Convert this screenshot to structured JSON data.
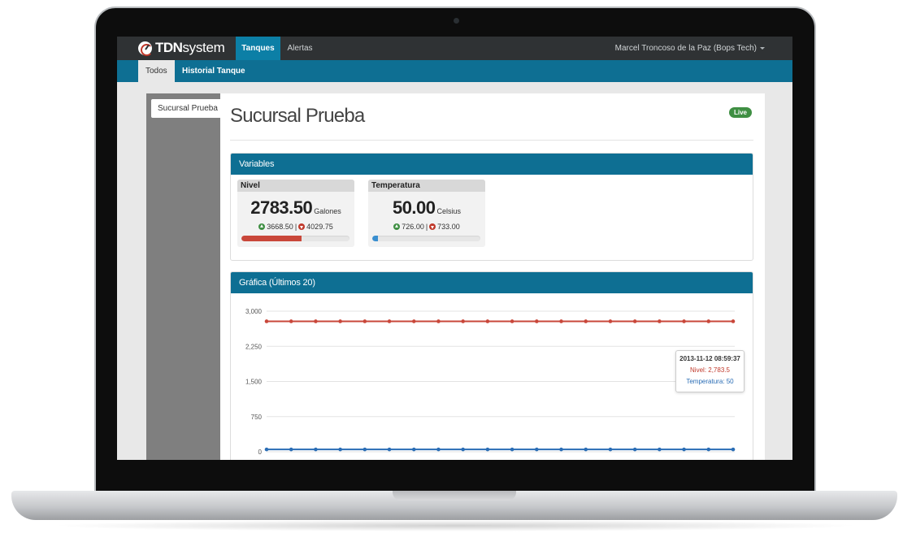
{
  "brand": {
    "name_bold": "TDN",
    "name_light": "system"
  },
  "nav": {
    "tabs": [
      {
        "label": "Tanques",
        "active": true
      },
      {
        "label": "Alertas",
        "active": false
      }
    ],
    "user": "Marcel Troncoso de la Paz (Bops Tech)"
  },
  "subnav": {
    "tabs": [
      {
        "label": "Todos",
        "active": true
      },
      {
        "label": "Historial Tanque",
        "active": false
      }
    ]
  },
  "sidebar": {
    "items": [
      {
        "label": "Sucursal Prueba"
      }
    ]
  },
  "main": {
    "title": "Sucursal Prueba",
    "badge": "Live",
    "variables_panel": {
      "title": "Variables",
      "cards": [
        {
          "name": "Nivel",
          "value": "2783.50",
          "unit": "Galones",
          "min": "3668.50",
          "max": "4029.75",
          "progress_percent": 56,
          "progress_color": "#c9473a"
        },
        {
          "name": "Temperatura",
          "value": "50.00",
          "unit": "Celsius",
          "min": "726.00",
          "max": "733.00",
          "progress_percent": 5,
          "progress_color": "#3a8fd0"
        }
      ]
    },
    "chart_panel": {
      "title": "Gráfica (Últimos 20)"
    }
  },
  "chart_data": {
    "type": "line",
    "title": "Gráfica (Últimos 20)",
    "ylim": [
      0,
      3000
    ],
    "yticks": [
      "3,000",
      "2,250",
      "1,500",
      "750",
      "0"
    ],
    "grid": true,
    "series": [
      {
        "name": "Nivel",
        "color": "#c9473a",
        "values": [
          2783.5,
          2783.5,
          2783.5,
          2783.5,
          2783.5,
          2783.5,
          2783.5,
          2783.5,
          2783.5,
          2783.5,
          2783.5,
          2783.5,
          2783.5,
          2783.5,
          2783.5,
          2783.5,
          2783.5,
          2783.5,
          2783.5,
          2783.5
        ]
      },
      {
        "name": "Temperatura",
        "color": "#2a6db5",
        "values": [
          50,
          50,
          50,
          50,
          50,
          50,
          50,
          50,
          50,
          50,
          50,
          50,
          50,
          50,
          50,
          50,
          50,
          50,
          50,
          50
        ]
      }
    ],
    "tooltip": {
      "timestamp": "2013-11-12 08:59:37",
      "nivel": "Nivel: 2,783.5",
      "temperatura": "Temperatura: 50"
    }
  }
}
